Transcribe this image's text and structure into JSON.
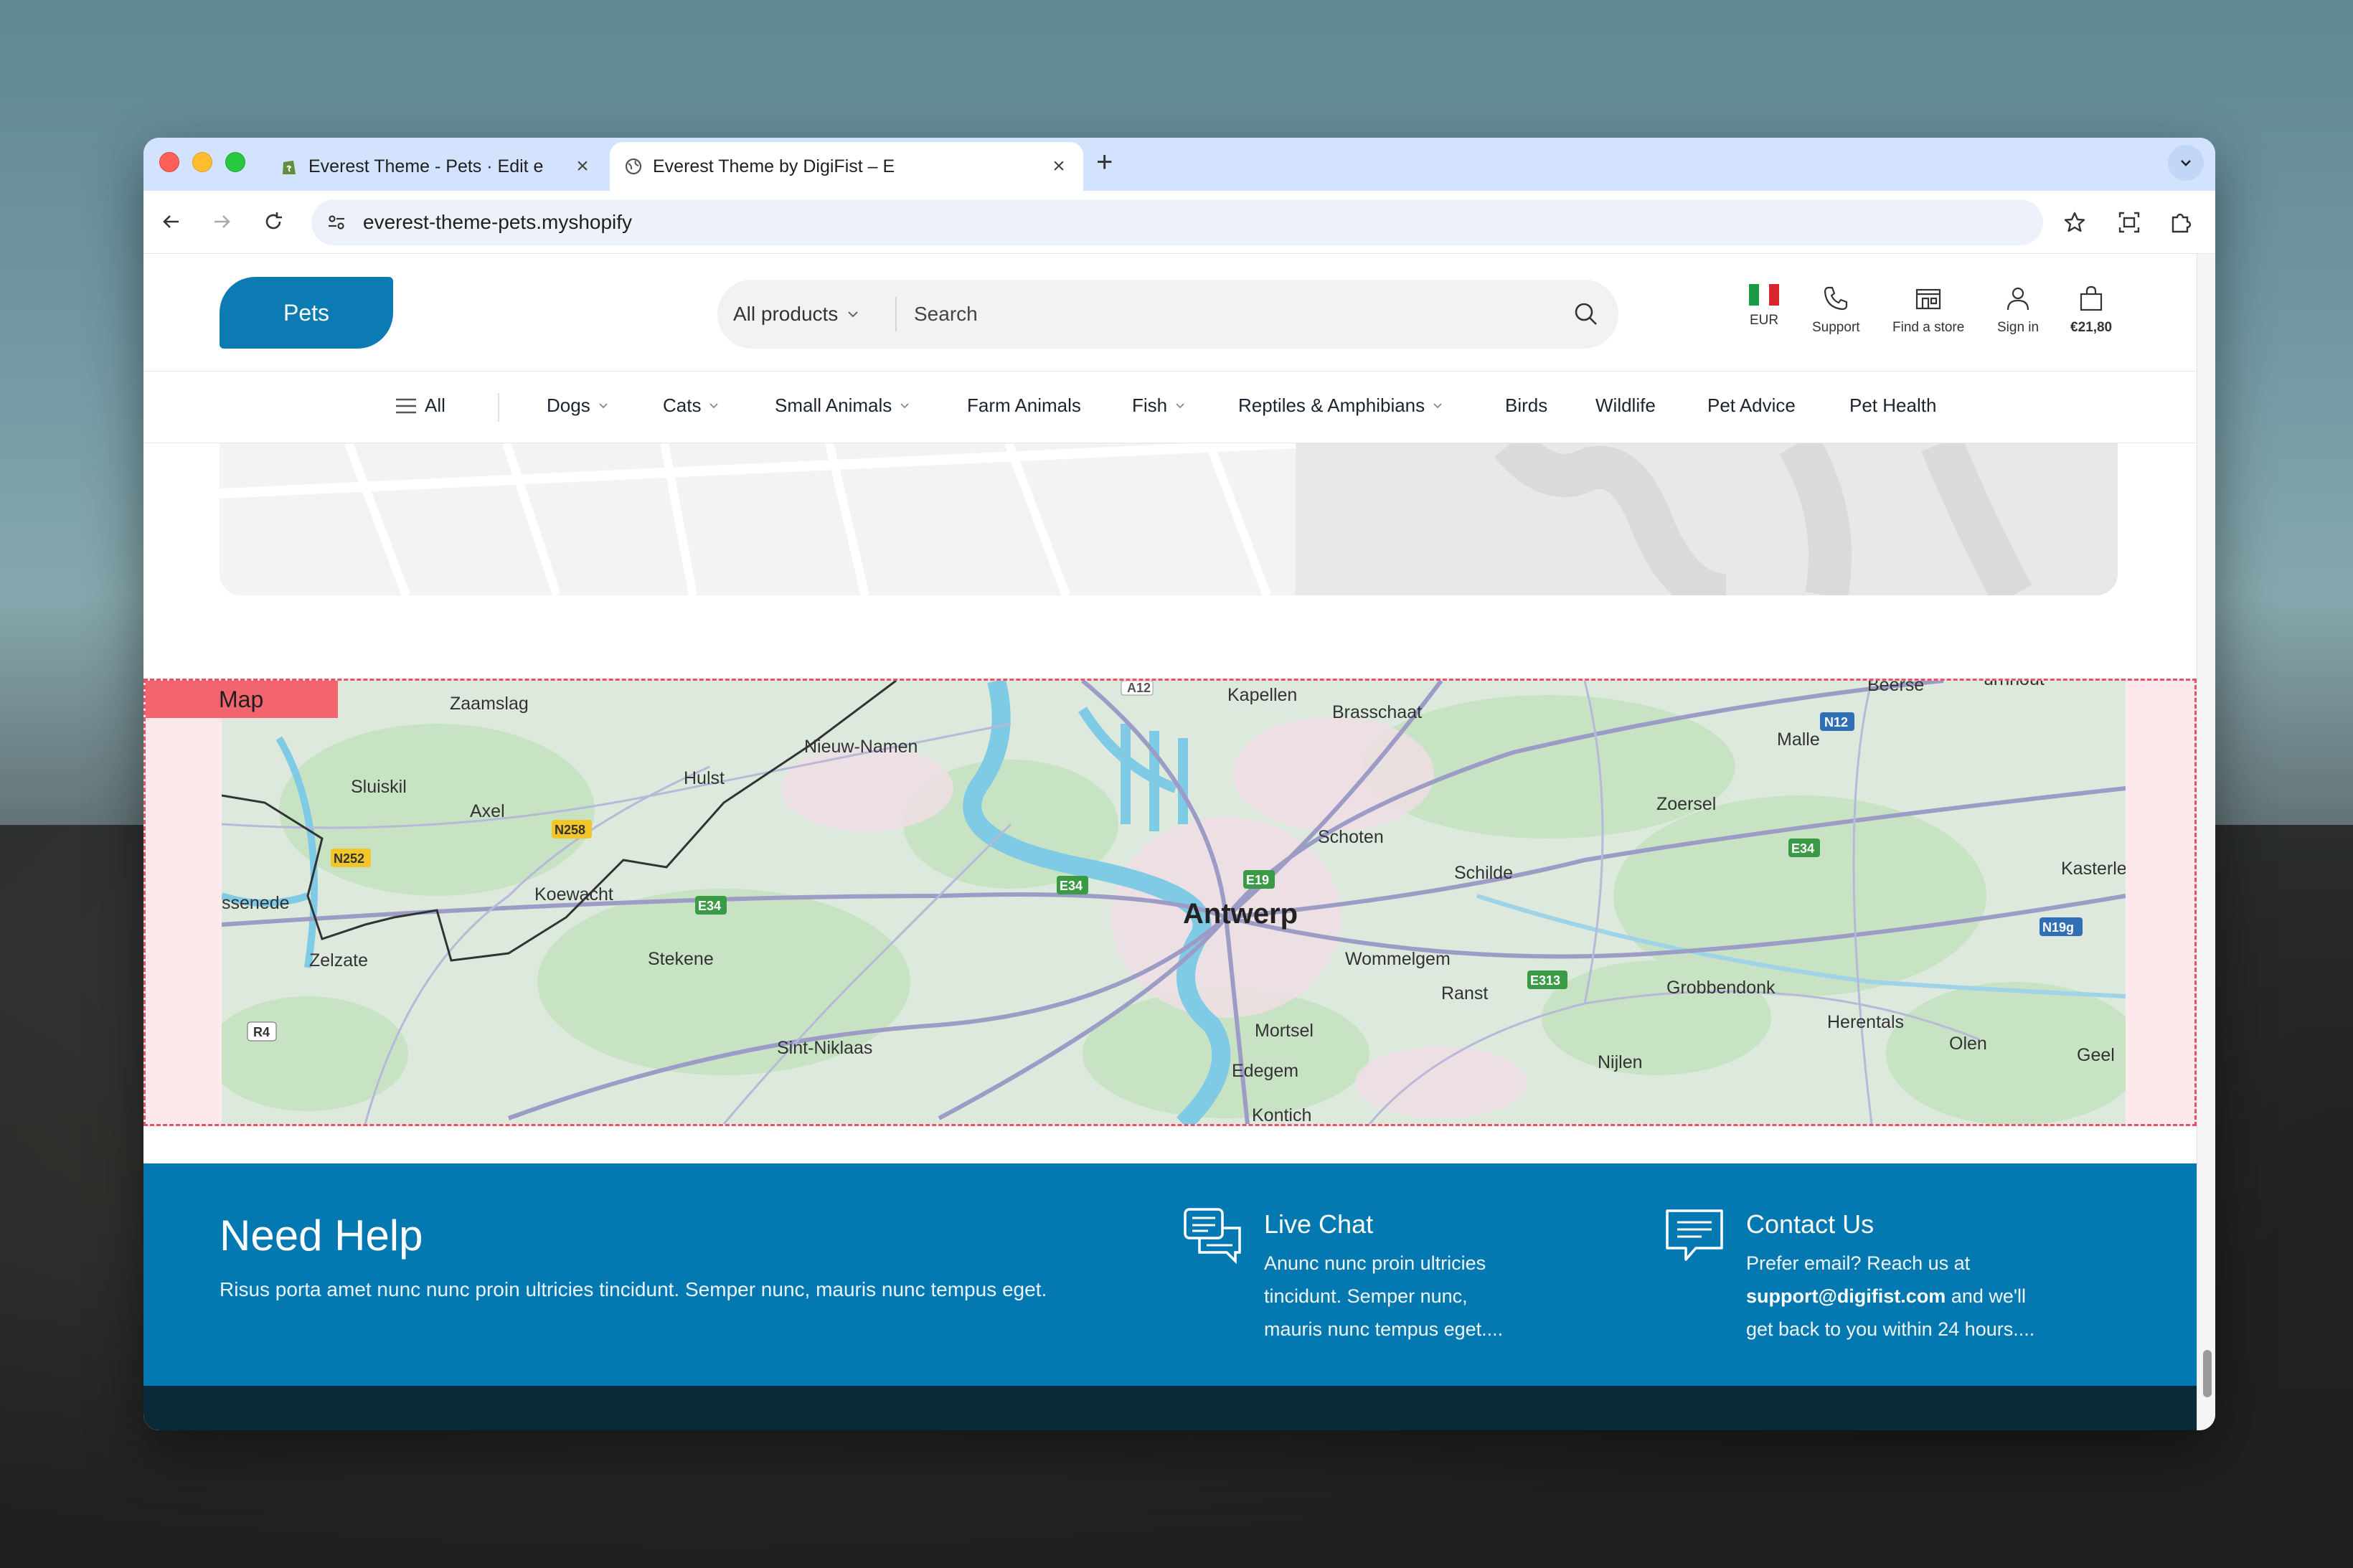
{
  "browser": {
    "tabs": [
      {
        "title": "Everest Theme - Pets · Edit e",
        "active": false
      },
      {
        "title": "Everest Theme by DigiFist – E",
        "active": true
      }
    ],
    "new_tab_symbol": "+",
    "close_symbol": "×",
    "url": "everest-theme-pets.myshopify"
  },
  "header": {
    "logo_text": "Pets",
    "search": {
      "category": "All products",
      "placeholder": "Search"
    },
    "currency": "EUR",
    "support_label": "Support",
    "find_store_label": "Find a store",
    "sign_in_label": "Sign in",
    "cart_total": "€21,80"
  },
  "nav": {
    "all_label": "All",
    "items": [
      {
        "label": "Dogs",
        "dropdown": true
      },
      {
        "label": "Cats",
        "dropdown": true
      },
      {
        "label": "Small Animals",
        "dropdown": true
      },
      {
        "label": "Farm Animals",
        "dropdown": false
      },
      {
        "label": "Fish",
        "dropdown": true
      },
      {
        "label": "Reptiles & Amphibians",
        "dropdown": true
      },
      {
        "label": "Birds",
        "dropdown": false
      },
      {
        "label": "Wildlife",
        "dropdown": false
      },
      {
        "label": "Pet Advice",
        "dropdown": false
      },
      {
        "label": "Pet Health",
        "dropdown": false
      }
    ]
  },
  "map_section": {
    "tag": "Map",
    "places": [
      "Zaamslag",
      "Sluiskil",
      "Axel",
      "Hulst",
      "Nieuw-Namen",
      "Kapellen",
      "Brasschaat",
      "Beerse",
      "Malle",
      "Zoersel",
      "Schoten",
      "Schilde",
      "Kasterlee",
      "Koewacht",
      "Antwerp",
      "Wommelgem",
      "Ranst",
      "Grobbendonk",
      "Herentals",
      "Olen",
      "Geel",
      "Nijlen",
      "Mortsel",
      "Edegem",
      "Zelzate",
      "Stekene",
      "Sint-Niklaas",
      "ssenede",
      "Kontich",
      "urnhout"
    ],
    "roads": [
      "A12",
      "N12",
      "N258",
      "N252",
      "E34",
      "E19",
      "E313",
      "N19g",
      "R4"
    ]
  },
  "help": {
    "title": "Need Help",
    "text": "Risus porta amet nunc nunc proin ultricies tincidunt. Semper nunc, mauris nunc tempus eget.",
    "live_chat": {
      "title": "Live Chat",
      "lines": [
        "Anunc nunc proin ultricies",
        "tincidunt. Semper nunc,",
        "mauris nunc tempus eget...."
      ]
    },
    "contact": {
      "title": "Contact Us",
      "line1": "Prefer email? Reach us at",
      "email": "support@digifist.com",
      "line2_suffix": " and we'll",
      "line3": "get back to you within 24 hours...."
    }
  },
  "colors": {
    "brand": "#0c7bb3",
    "help_bg": "#0478b0",
    "map_tag": "#f2646e",
    "map_border": "#e25566"
  }
}
